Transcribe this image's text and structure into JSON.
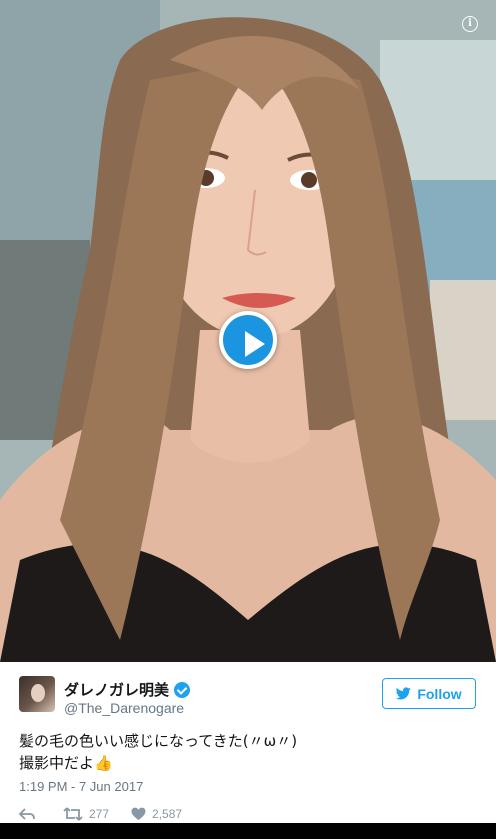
{
  "media": {
    "info_icon": "info-icon",
    "play_icon": "play-icon"
  },
  "tweet": {
    "display_name": "ダレノガレ明美",
    "handle": "@The_Darenogare",
    "follow_label": "Follow",
    "text": "髪の毛の色いい感じになってきた(〃ω〃)\n撮影中だよ👍",
    "timestamp": "1:19 PM - 7 Jun 2017",
    "retweets": "277",
    "likes": "2,587"
  },
  "colors": {
    "accent": "#1da1f2",
    "play": "#1b95e0",
    "muted": "#657786"
  }
}
